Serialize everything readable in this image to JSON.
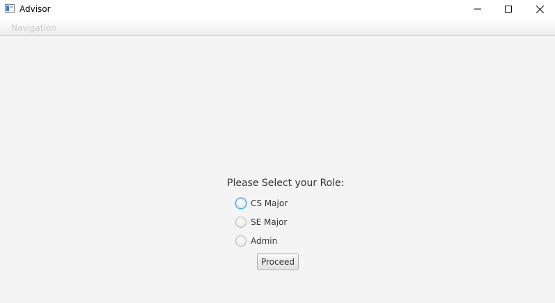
{
  "window": {
    "title": "Advisor",
    "controls": {
      "minimize_icon": "minimize-icon",
      "maximize_icon": "maximize-icon",
      "close_icon": "close-icon"
    }
  },
  "menubar": {
    "items": [
      {
        "label": "Navigation"
      }
    ]
  },
  "form": {
    "prompt": "Please Select your Role:",
    "roles": [
      {
        "label": "CS Major",
        "focused": true,
        "selected": false
      },
      {
        "label": "SE Major",
        "focused": false,
        "selected": false
      },
      {
        "label": "Admin",
        "focused": false,
        "selected": false
      }
    ],
    "proceed_label": "Proceed"
  },
  "colors": {
    "content_background": "#f4f4f4",
    "focus_ring": "#3aa3d8",
    "disabled_menu_text": "#c8c8c8"
  }
}
